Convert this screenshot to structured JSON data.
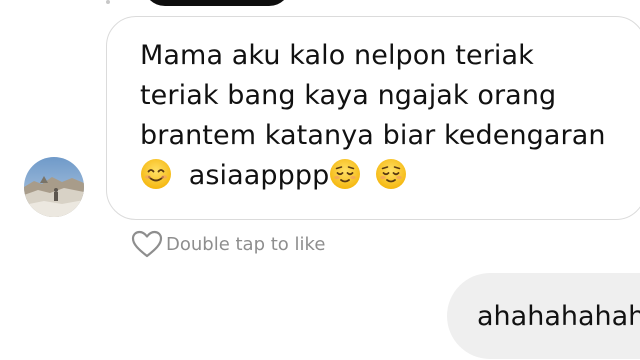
{
  "incoming_message": {
    "line1": "Mama aku kalo nelpon teriak",
    "line2": "teriak bang kaya ngajak orang",
    "line3": "brantem katanya biar kedengaran",
    "tail_text": "asiaapppp"
  },
  "like_prompt": "Double tap to like",
  "outgoing_message": {
    "text": "ahahahahaha"
  },
  "colors": {
    "bubble_border": "#dbdbdb",
    "outgoing_bubble": "#efefef",
    "muted_text": "#8e8e8e",
    "primary_text": "#111111"
  },
  "icons": [
    "heart-icon",
    "smiling-face-emoji",
    "relieved-face-emoji"
  ]
}
